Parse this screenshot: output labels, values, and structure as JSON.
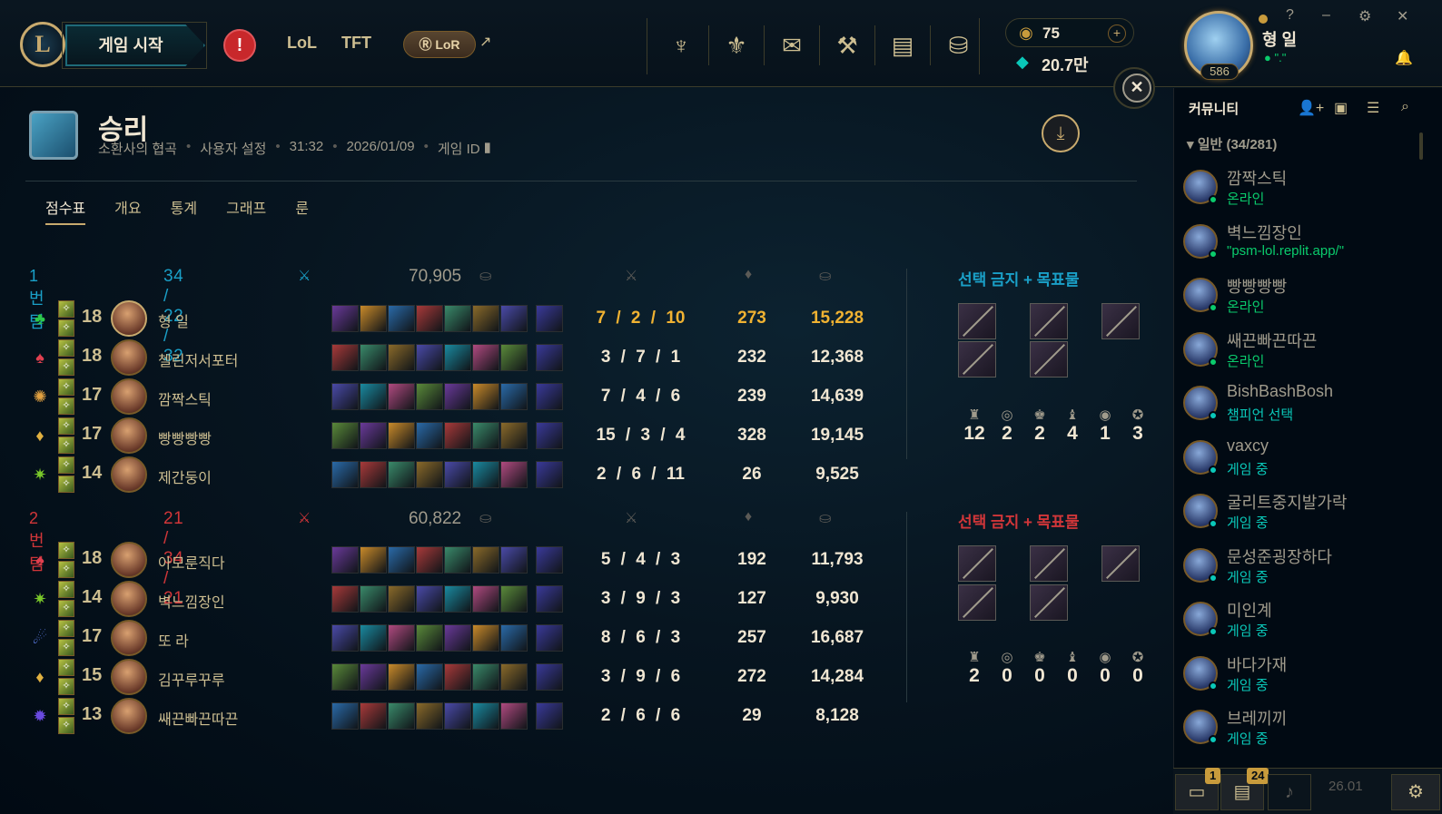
{
  "colors": {
    "gold": "#c8aa6e",
    "blue_team": "#1aa0c8",
    "red_team": "#d13639",
    "online": "#0acb6c",
    "ingame": "#0ac8b9"
  },
  "nav": {
    "play_label": "게임 시작",
    "alert_icon": "!",
    "links": [
      "LoL",
      "TFT"
    ],
    "lor_label": "LoR",
    "ext_icon": "↗",
    "icons": [
      "ranked-icon",
      "clash-icon",
      "store-icon",
      "loot-icon",
      "collection-icon",
      "coins-icon"
    ]
  },
  "currency": {
    "rp_value": "75",
    "plus_label": "+",
    "be_value": "20.7만"
  },
  "user": {
    "name": "형 일",
    "status": "\".\"",
    "level": "586",
    "window_controls": [
      "?",
      "–",
      "⚙",
      "✕"
    ]
  },
  "match": {
    "close_label": "✕",
    "title": "승리",
    "mode": "소환사의 협곡",
    "setting": "사용자 설정",
    "duration": "31:32",
    "date": "2026/01/09",
    "game_id_label": "게임 ID"
  },
  "tabs": [
    "점수표",
    "개요",
    "통계",
    "그래프",
    "룬"
  ],
  "team1": {
    "label": "1번 팀",
    "kda": "34 / 22 / 32",
    "gold": "70,905",
    "bans_title": "선택 금지 + 목표물",
    "objectives": [
      "12",
      "2",
      "2",
      "4",
      "1",
      "3"
    ],
    "players": [
      {
        "level": "18",
        "name": "형 일",
        "kda": "7 / 2 / 10",
        "cs": "273",
        "gold": "15,228",
        "rune": "♣",
        "rune_color": "#2ec84a"
      },
      {
        "level": "18",
        "name": "첼린저서포터",
        "kda": "3 / 7 / 1",
        "cs": "232",
        "gold": "12,368",
        "rune": "♠",
        "rune_color": "#e04050"
      },
      {
        "level": "17",
        "name": "깜짝스틱",
        "kda": "7 / 4 / 6",
        "cs": "239",
        "gold": "14,639",
        "rune": "✺",
        "rune_color": "#e0a040"
      },
      {
        "level": "17",
        "name": "빵빵빵빵",
        "kda": "15 / 3 / 4",
        "cs": "328",
        "gold": "19,145",
        "rune": "♦",
        "rune_color": "#e0b040"
      },
      {
        "level": "14",
        "name": "제간둥이",
        "kda": "2 / 6 / 11",
        "cs": "26",
        "gold": "9,525",
        "rune": "✷",
        "rune_color": "#7ac82a"
      }
    ]
  },
  "team2": {
    "label": "2번 팀",
    "kda": "21 / 34 / 21",
    "gold": "60,822",
    "bans_title": "선택 금지 + 목표물",
    "objectives": [
      "2",
      "0",
      "0",
      "0",
      "0",
      "0"
    ],
    "players": [
      {
        "level": "18",
        "name": "아모룬직다",
        "kda": "5 / 4 / 3",
        "cs": "192",
        "gold": "11,793",
        "rune": "♠",
        "rune_color": "#e04050"
      },
      {
        "level": "14",
        "name": "벽느낌장인",
        "kda": "3 / 9 / 3",
        "cs": "127",
        "gold": "9,930",
        "rune": "✷",
        "rune_color": "#7ac82a"
      },
      {
        "level": "17",
        "name": "또 라",
        "kda": "8 / 6 / 3",
        "cs": "257",
        "gold": "16,687",
        "rune": "☄",
        "rune_color": "#5a7ae0"
      },
      {
        "level": "15",
        "name": "김꾸루꾸루",
        "kda": "3 / 9 / 6",
        "cs": "272",
        "gold": "14,284",
        "rune": "♦",
        "rune_color": "#e0b040"
      },
      {
        "level": "13",
        "name": "쌔끈빠끈따끈",
        "kda": "2 / 6 / 6",
        "cs": "29",
        "gold": "8,128",
        "rune": "✹",
        "rune_color": "#6a4ae0"
      }
    ]
  },
  "social": {
    "title": "커뮤니티",
    "group": "일반 (34/281)",
    "friends": [
      {
        "name": "깜짝스틱",
        "status": "온라인",
        "kind": "online"
      },
      {
        "name": "벽느낌장인",
        "status": "\"psm-lol.replit.app/\"",
        "kind": "online"
      },
      {
        "name": "빵빵빵빵",
        "status": "온라인",
        "kind": "online"
      },
      {
        "name": "쌔끈빠끈따끈",
        "status": "온라인",
        "kind": "online"
      },
      {
        "name": "BishBashBosh",
        "status": "챔피언 선택",
        "kind": "ingame"
      },
      {
        "name": "vaxcy",
        "status": "게임 중",
        "kind": "ingame"
      },
      {
        "name": "굴리트중지발가락",
        "status": "게임 중",
        "kind": "ingame"
      },
      {
        "name": "문성준굉장하다",
        "status": "게임 중",
        "kind": "ingame"
      },
      {
        "name": "미인계",
        "status": "게임 중",
        "kind": "ingame"
      },
      {
        "name": "바다가재",
        "status": "게임 중",
        "kind": "ingame"
      },
      {
        "name": "브레끼끼",
        "status": "게임 중",
        "kind": "ingame"
      }
    ]
  },
  "bottom": {
    "chat_badge": "1",
    "msg_badge": "24",
    "version": "26.01"
  }
}
